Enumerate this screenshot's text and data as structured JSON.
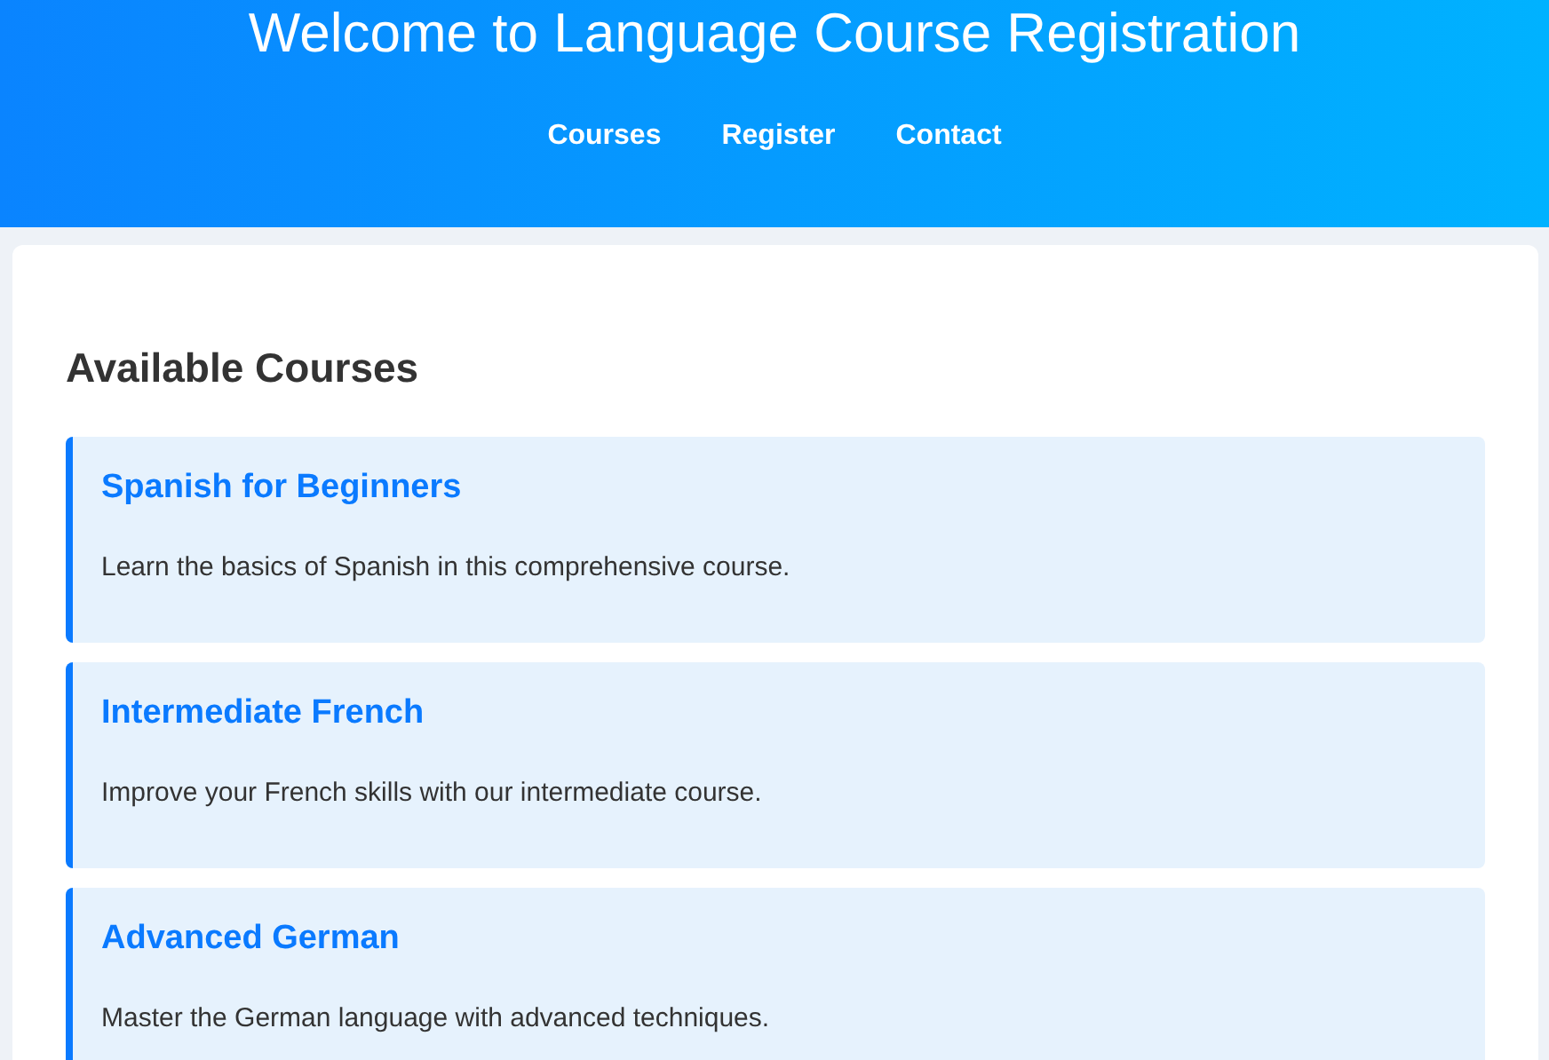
{
  "header": {
    "title": "Welcome to Language Course Registration",
    "nav": [
      {
        "label": "Courses"
      },
      {
        "label": "Register"
      },
      {
        "label": "Contact"
      }
    ]
  },
  "courses_section": {
    "heading": "Available Courses",
    "courses": [
      {
        "title": "Spanish for Beginners",
        "description": "Learn the basics of Spanish in this comprehensive course."
      },
      {
        "title": "Intermediate French",
        "description": "Improve your French skills with our intermediate course."
      },
      {
        "title": "Advanced German",
        "description": "Master the German language with advanced techniques."
      }
    ]
  }
}
